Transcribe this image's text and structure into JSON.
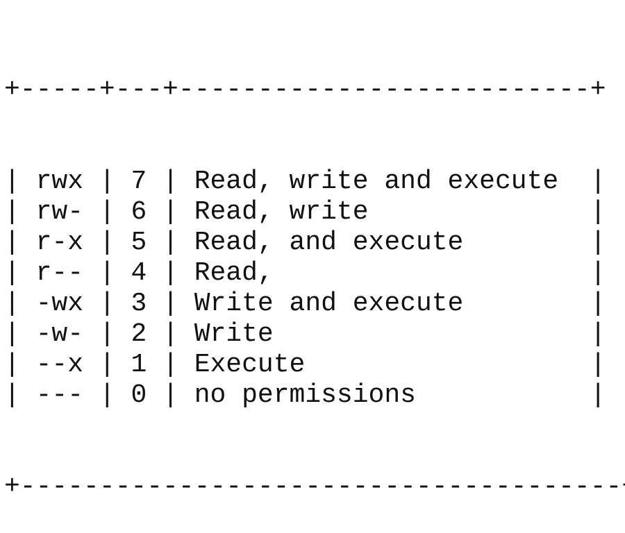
{
  "table": {
    "border_top": "+-----+---+--------------------------+",
    "border_bottom": "+--------------------------------------+",
    "rows": [
      {
        "symbolic": "rwx",
        "octal": "7",
        "description": "Read, write and execute"
      },
      {
        "symbolic": "rw-",
        "octal": "6",
        "description": "Read, write"
      },
      {
        "symbolic": "r-x",
        "octal": "5",
        "description": "Read, and execute"
      },
      {
        "symbolic": "r--",
        "octal": "4",
        "description": "Read,"
      },
      {
        "symbolic": "-wx",
        "octal": "3",
        "description": "Write and execute"
      },
      {
        "symbolic": "-w-",
        "octal": "2",
        "description": "Write"
      },
      {
        "symbolic": "--x",
        "octal": "1",
        "description": "Execute"
      },
      {
        "symbolic": "---",
        "octal": "0",
        "description": "no permissions"
      }
    ]
  }
}
